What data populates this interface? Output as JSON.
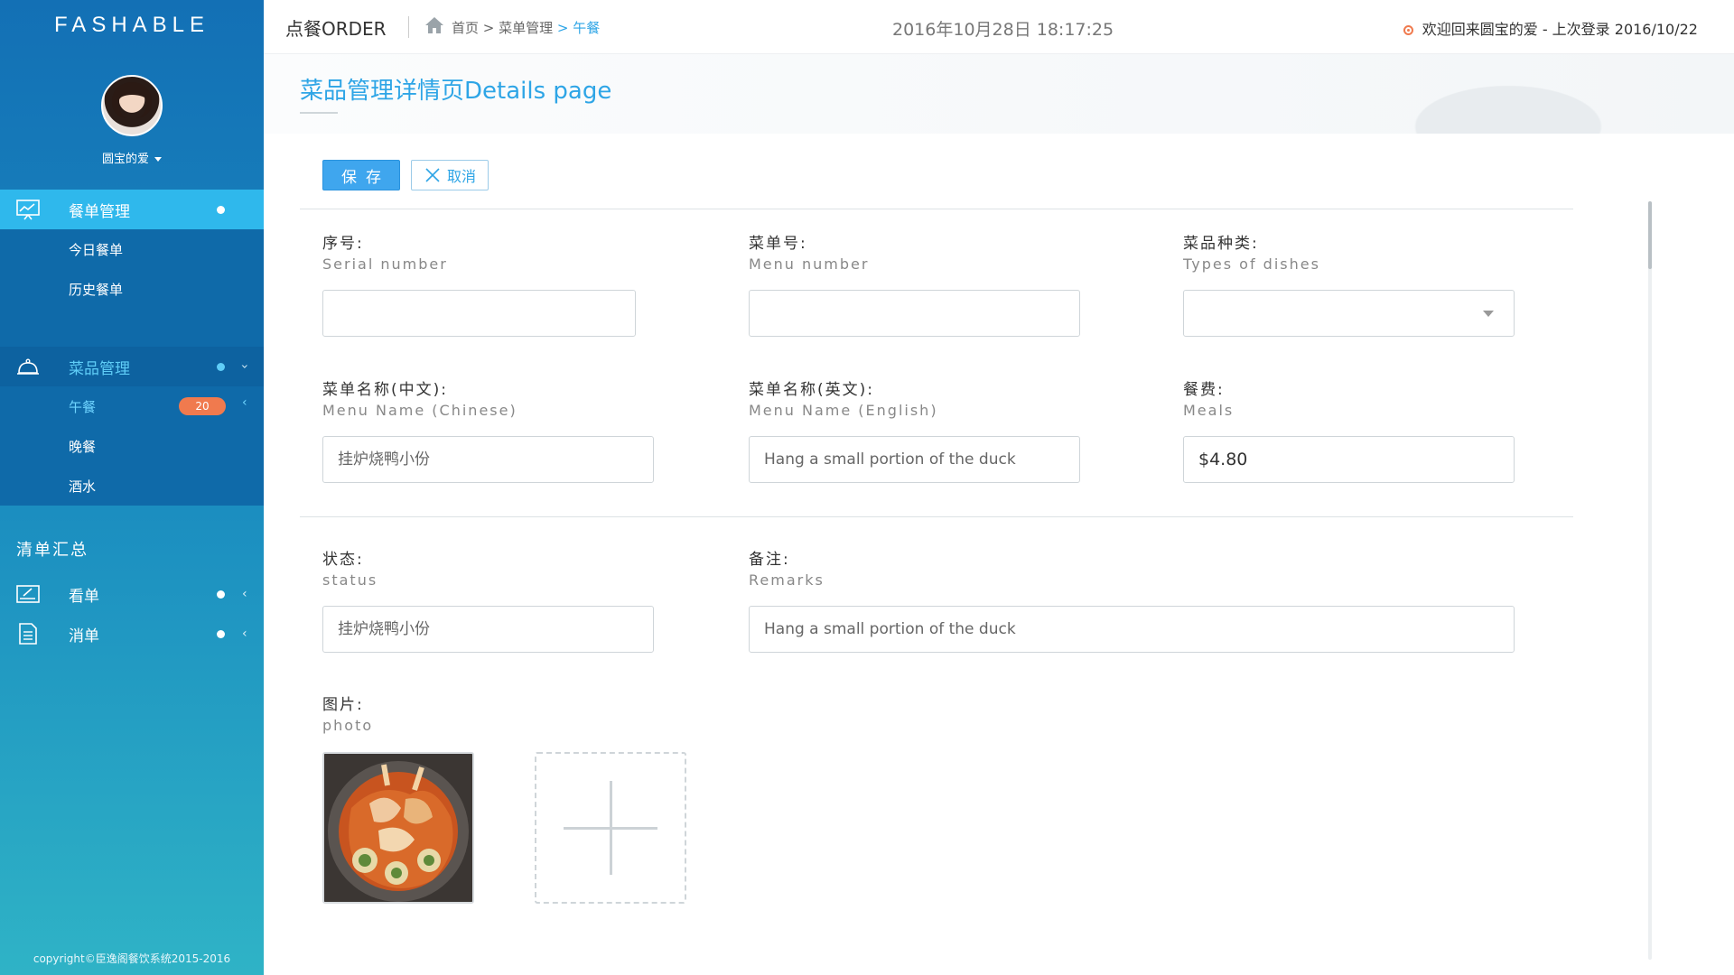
{
  "sidebar": {
    "brand": "FASHABLE",
    "username": "圆宝的爱",
    "menu": [
      {
        "label": "餐单管理",
        "icon": "chart-board-icon",
        "active": true,
        "children": [
          {
            "label": "今日餐单"
          },
          {
            "label": "历史餐单"
          }
        ]
      },
      {
        "label": "菜品管理",
        "icon": "cloche-icon",
        "active": false,
        "children": [
          {
            "label": "午餐",
            "badge": "20",
            "active": true
          },
          {
            "label": "晚餐"
          },
          {
            "label": "酒水"
          }
        ]
      }
    ],
    "section_title": "清单汇总",
    "summary": [
      {
        "label": "看单",
        "icon": "edit-board-icon"
      },
      {
        "label": "消单",
        "icon": "document-icon"
      }
    ],
    "copyright": "copyright©臣逸阁餐饮系统2015-2016"
  },
  "topbar": {
    "title": "点餐ORDER",
    "breadcrumb": {
      "home": "首页",
      "sep": " > ",
      "level1": "菜单管理",
      "current": "午餐"
    },
    "datetime": "2016年10月28日 18:17:25",
    "welcome": "欢迎回来圆宝的爱 - 上次登录 2016/10/22"
  },
  "page": {
    "title": "菜品管理详情页Details page"
  },
  "toolbar": {
    "save_label": "保存",
    "cancel_label": "取消"
  },
  "form": {
    "serial": {
      "label": "序号:",
      "sub": "Serial number",
      "value": ""
    },
    "menu_number": {
      "label": "菜单号:",
      "sub": "Menu number",
      "value": ""
    },
    "dish_type": {
      "label": "菜品种类:",
      "sub": "Types of dishes",
      "value": ""
    },
    "name_cn": {
      "label": "菜单名称(中文):",
      "sub": "Menu Name (Chinese)",
      "placeholder": "挂炉烧鸭小份"
    },
    "name_en": {
      "label": "菜单名称(英文):",
      "sub": "Menu Name (English)",
      "placeholder": "Hang a small portion of the duck"
    },
    "meals": {
      "label": "餐费:",
      "sub": "Meals",
      "value": "$4.80"
    },
    "status": {
      "label": "状态:",
      "sub": "status",
      "placeholder": "挂炉烧鸭小份"
    },
    "remarks": {
      "label": "备注:",
      "sub": "Remarks",
      "placeholder": "Hang a small portion of the duck"
    },
    "photo": {
      "label": "图片:",
      "sub": "photo"
    }
  }
}
